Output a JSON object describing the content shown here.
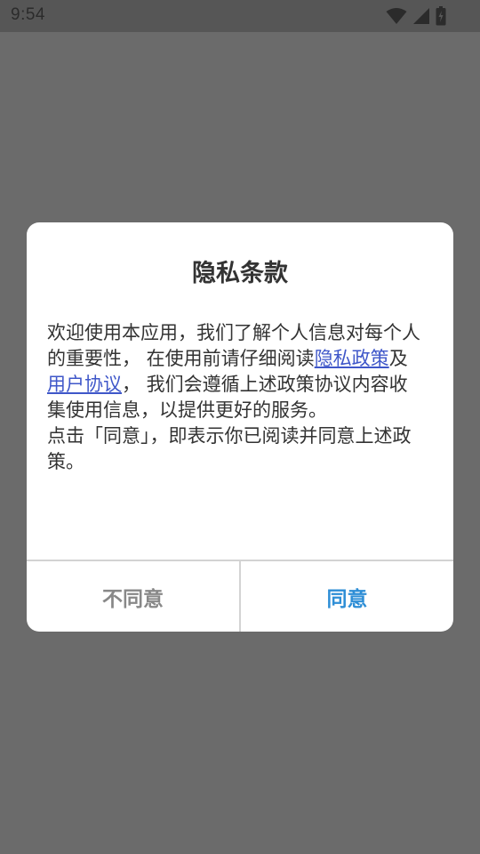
{
  "status_bar": {
    "time": "9:54",
    "icons": [
      "wifi-icon",
      "signal-icon",
      "battery-icon"
    ]
  },
  "dialog": {
    "title": "隐私条款",
    "para1_before": "欢迎使用本应用，我们了解个人信息对每个人的重要性， 在使用前请仔细阅读",
    "privacy_link": "隐私政策",
    "and": "及",
    "user_link": "用户协议",
    "para1_after": "， 我们会遵循上述政策协议内容收集使用信息，以提供更好的服务。",
    "para2": "点击「同意」，即表示你已阅读并同意上述政策。",
    "disagree_label": "不同意",
    "agree_label": "同意"
  },
  "colors": {
    "scrim": "#6b6b6b",
    "link": "#3f57c9",
    "agree": "#2e8ed6",
    "disagree": "#888888"
  }
}
